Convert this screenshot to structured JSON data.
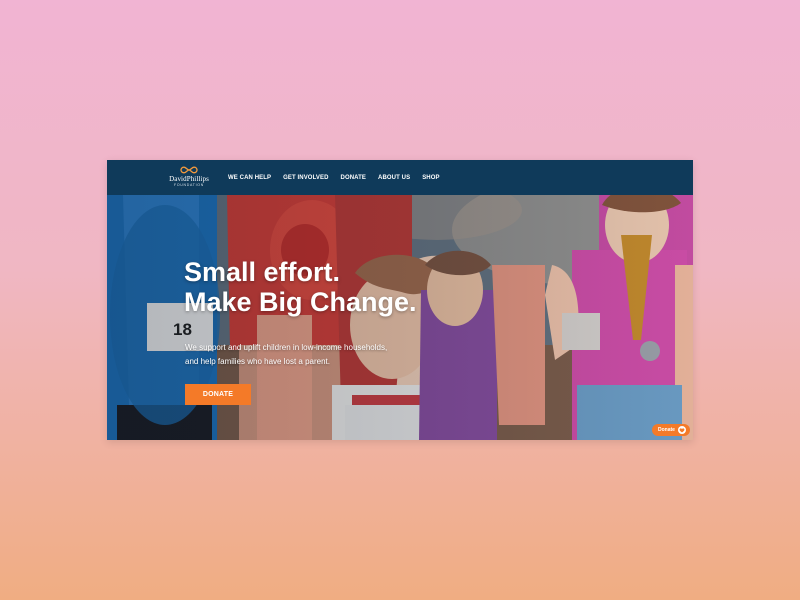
{
  "logo": {
    "name": "DavidPhillips",
    "subtitle": "FOUNDATION",
    "icon": "infinity-logo-icon"
  },
  "nav": {
    "items": [
      {
        "label": "WE CAN HELP"
      },
      {
        "label": "GET INVOLVED"
      },
      {
        "label": "DONATE"
      },
      {
        "label": "ABOUT US"
      },
      {
        "label": "SHOP"
      }
    ]
  },
  "hero": {
    "title_line1": "Small effort.",
    "title_line2": "Make Big Change.",
    "text_line1": "We support and uplift children in low-income households,",
    "text_line2": "and help families who have lost a parent.",
    "button_label": "DONATE",
    "bib_number": "18"
  },
  "floating_donate": {
    "label": "Donate",
    "icon": "heart-icon"
  },
  "colors": {
    "navbar": "#0f3a5a",
    "accent": "#f47a28",
    "text": "#ffffff"
  }
}
